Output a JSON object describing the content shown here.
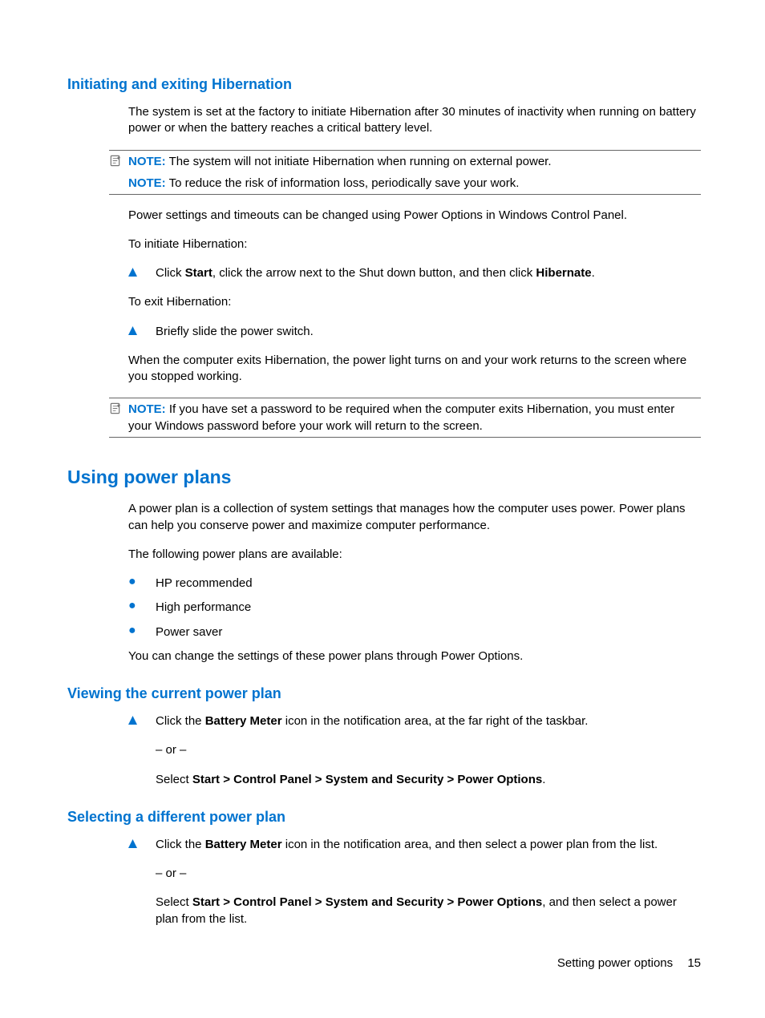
{
  "section1": {
    "title": "Initiating and exiting Hibernation",
    "p1": "The system is set at the factory to initiate Hibernation after 30 minutes of inactivity when running on battery power or when the battery reaches a critical battery level.",
    "note1_label": "NOTE:",
    "note1_text": "The system will not initiate Hibernation when running on external power.",
    "note2_label": "NOTE:",
    "note2_text": "To reduce the risk of information loss, periodically save your work.",
    "p2": "Power settings and timeouts can be changed using Power Options in Windows Control Panel.",
    "p3": "To initiate Hibernation:",
    "step1_a": "Click ",
    "step1_b": "Start",
    "step1_c": ", click the arrow next to the Shut down button, and then click ",
    "step1_d": "Hibernate",
    "step1_e": ".",
    "p4": "To exit Hibernation:",
    "step2": "Briefly slide the power switch.",
    "p5": "When the computer exits Hibernation, the power light turns on and your work returns to the screen where you stopped working.",
    "note3_label": "NOTE:",
    "note3_text": "If you have set a password to be required when the computer exits Hibernation, you must enter your Windows password before your work will return to the screen."
  },
  "section2": {
    "title": "Using power plans",
    "p1": "A power plan is a collection of system settings that manages how the computer uses power. Power plans can help you conserve power and maximize computer performance.",
    "p2": "The following power plans are available:",
    "bullets": [
      "HP recommended",
      "High performance",
      "Power saver"
    ],
    "p3": "You can change the settings of these power plans through Power Options."
  },
  "section3": {
    "title": "Viewing the current power plan",
    "step_a": "Click the ",
    "step_b": "Battery Meter",
    "step_c": " icon in the notification area, at the far right of the taskbar.",
    "or": "– or –",
    "alt_a": "Select ",
    "alt_b": "Start > Control Panel > System and Security > Power Options",
    "alt_c": "."
  },
  "section4": {
    "title": "Selecting a different power plan",
    "step_a": "Click the ",
    "step_b": "Battery Meter",
    "step_c": " icon in the notification area, and then select a power plan from the list.",
    "or": "– or –",
    "alt_a": "Select ",
    "alt_b": "Start > Control Panel > System and Security > Power Options",
    "alt_c": ", and then select a power plan from the list."
  },
  "footer": {
    "text": "Setting power options",
    "page": "15"
  }
}
